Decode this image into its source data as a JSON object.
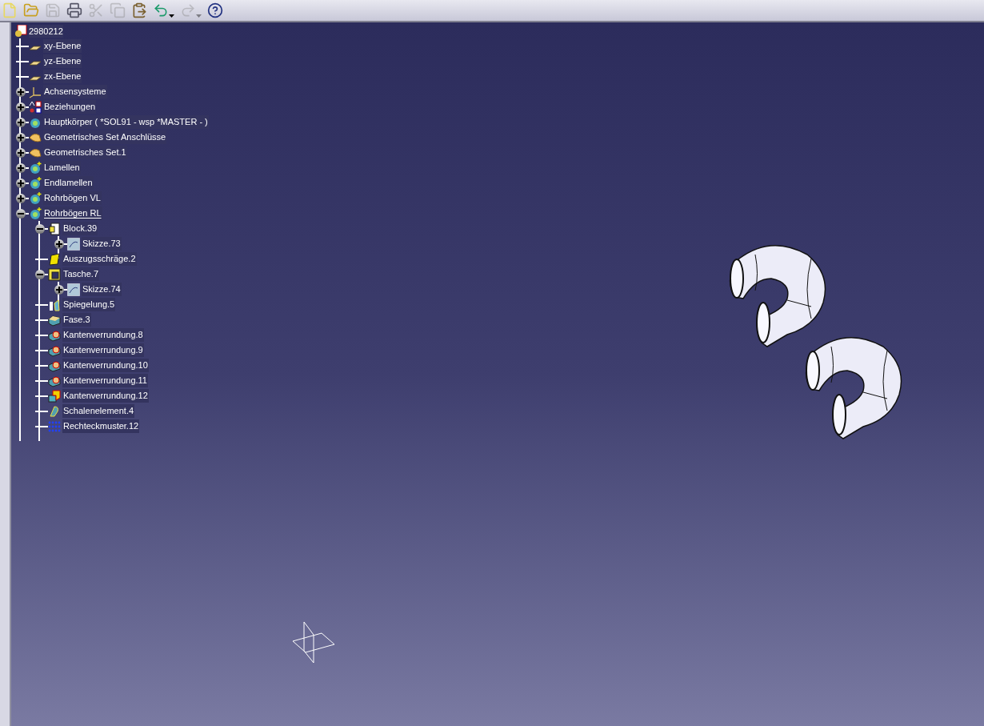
{
  "toolbar": [
    {
      "kind": "new",
      "disabled": false
    },
    {
      "kind": "open",
      "disabled": false
    },
    {
      "kind": "save",
      "disabled": true
    },
    {
      "kind": "print",
      "disabled": false
    },
    {
      "kind": "cut",
      "disabled": true
    },
    {
      "kind": "copy",
      "disabled": true
    },
    {
      "kind": "paste",
      "disabled": false
    },
    {
      "kind": "undo",
      "disabled": false
    },
    {
      "kind": "redo",
      "disabled": true
    },
    {
      "kind": "help",
      "disabled": false
    }
  ],
  "tree": {
    "root": "2980212",
    "items": [
      {
        "label": "xy-Ebene",
        "kind": "plane",
        "current": false
      },
      {
        "label": "yz-Ebene",
        "kind": "plane",
        "current": false
      },
      {
        "label": "zx-Ebene",
        "kind": "plane",
        "current": false
      },
      {
        "label": "Achsensysteme",
        "kind": "axis",
        "expanded": false,
        "current": false
      },
      {
        "label": "Beziehungen",
        "kind": "relations",
        "expanded": false,
        "current": false
      },
      {
        "label": "Hauptkörper ( *SOL91 - wsp *MASTER -  )",
        "kind": "body",
        "expanded": false,
        "current": false
      },
      {
        "label": "Geometrisches Set Anschlüsse",
        "kind": "geoset",
        "expanded": false,
        "current": false
      },
      {
        "label": "Geometrisches Set.1",
        "kind": "geoset",
        "expanded": false,
        "current": false
      },
      {
        "label": "Lamellen",
        "kind": "bodyplus",
        "expanded": false,
        "current": false
      },
      {
        "label": "Endlamellen",
        "kind": "bodyplus",
        "expanded": false,
        "current": false
      },
      {
        "label": "Rohrbögen VL",
        "kind": "bodyplus",
        "expanded": false,
        "current": false
      },
      {
        "label": "Rohrbögen RL",
        "kind": "bodyplus",
        "expanded": true,
        "current": true,
        "children": [
          {
            "label": "Block.39",
            "kind": "pad",
            "expanded": true,
            "children": [
              {
                "label": "Skizze.73",
                "kind": "sketch",
                "expanded": false
              }
            ]
          },
          {
            "label": "Auszugsschräge.2",
            "kind": "draft"
          },
          {
            "label": "Tasche.7",
            "kind": "pocket",
            "expanded": true,
            "children": [
              {
                "label": "Skizze.74",
                "kind": "sketch",
                "expanded": false
              }
            ]
          },
          {
            "label": "Spiegelung.5",
            "kind": "mirror"
          },
          {
            "label": "Fase.3",
            "kind": "chamfer"
          },
          {
            "label": "Kantenverrundung.8",
            "kind": "fillet"
          },
          {
            "label": "Kantenverrundung.9",
            "kind": "fillet"
          },
          {
            "label": "Kantenverrundung.10",
            "kind": "fillet"
          },
          {
            "label": "Kantenverrundung.11",
            "kind": "fillet"
          },
          {
            "label": "Kantenverrundung.12",
            "kind": "fillet2"
          },
          {
            "label": "Schalenelement.4",
            "kind": "shell"
          },
          {
            "label": "Rechteckmuster.12",
            "kind": "pattern"
          }
        ]
      }
    ]
  }
}
